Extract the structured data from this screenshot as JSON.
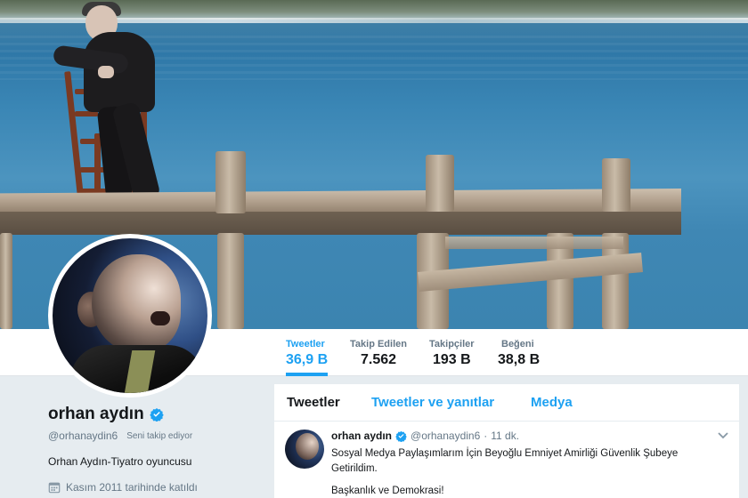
{
  "profile": {
    "name": "orhan aydın",
    "handle": "@orhanaydin6",
    "follows_you": "Seni takip ediyor",
    "bio": "Orhan Aydın-Tiyatro oyuncusu",
    "joined": "Kasım 2011 tarihinde katıldı",
    "icons": {
      "verified": "verified-badge-icon",
      "calendar": "calendar-icon"
    }
  },
  "stats": [
    {
      "label": "Tweetler",
      "value": "36,9 B",
      "active": true
    },
    {
      "label": "Takip Edilen",
      "value": "7.562",
      "active": false
    },
    {
      "label": "Takipçiler",
      "value": "193 B",
      "active": false
    },
    {
      "label": "Beğeni",
      "value": "38,8 B",
      "active": false
    }
  ],
  "timeline": {
    "tabs": [
      {
        "label": "Tweetler",
        "active": true
      },
      {
        "label": "Tweetler ve yanıtlar",
        "active": false
      },
      {
        "label": "Medya",
        "active": false
      }
    ],
    "tweet": {
      "name": "orhan aydın",
      "handle": "@orhanaydin6",
      "separator": "·",
      "time": "11 dk.",
      "line1": "Sosyal Medya Paylaşımlarım İçin Beyoğlu Emniyet Amirliği Güvenlik Şubeye",
      "line2": "Getirildim.",
      "line3": "Başkanlık ve Demokrasi!"
    }
  },
  "colors": {
    "accent": "#1da1f2",
    "text": "#14171a",
    "muted": "#657786",
    "page_bg": "#e6ecf0"
  }
}
